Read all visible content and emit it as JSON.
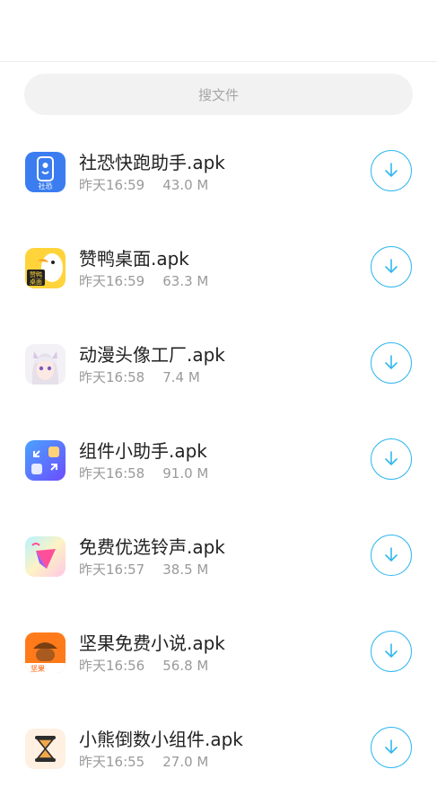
{
  "search": {
    "placeholder": "搜文件"
  },
  "files": [
    {
      "name": "社恐快跑助手.apk",
      "time": "昨天16:59",
      "size": "43.0 M",
      "icon": "shekong-app-icon"
    },
    {
      "name": "赞鸭桌面.apk",
      "time": "昨天16:59",
      "size": "63.3 M",
      "icon": "zanya-duck-app-icon"
    },
    {
      "name": "动漫头像工厂.apk",
      "time": "昨天16:58",
      "size": "7.4 M",
      "icon": "anime-avatar-app-icon"
    },
    {
      "name": "组件小助手.apk",
      "time": "昨天16:58",
      "size": "91.0 M",
      "icon": "widget-helper-app-icon"
    },
    {
      "name": "免费优选铃声.apk",
      "time": "昨天16:57",
      "size": "38.5 M",
      "icon": "ringtone-app-icon"
    },
    {
      "name": "坚果免费小说.apk",
      "time": "昨天16:56",
      "size": "56.8 M",
      "icon": "nut-novel-app-icon"
    },
    {
      "name": "小熊倒数小组件.apk",
      "time": "昨天16:55",
      "size": "27.0 M",
      "icon": "hourglass-app-icon"
    }
  ],
  "icon_text": {
    "shekong": "社恐",
    "zanya_1": "赞鸭",
    "zanya_2": "桌面",
    "nut": "坚果"
  },
  "colors": {
    "accent": "#32b8ee",
    "title": "#222222",
    "meta": "#9a9a9a",
    "search_bg": "#f2f2f2"
  }
}
